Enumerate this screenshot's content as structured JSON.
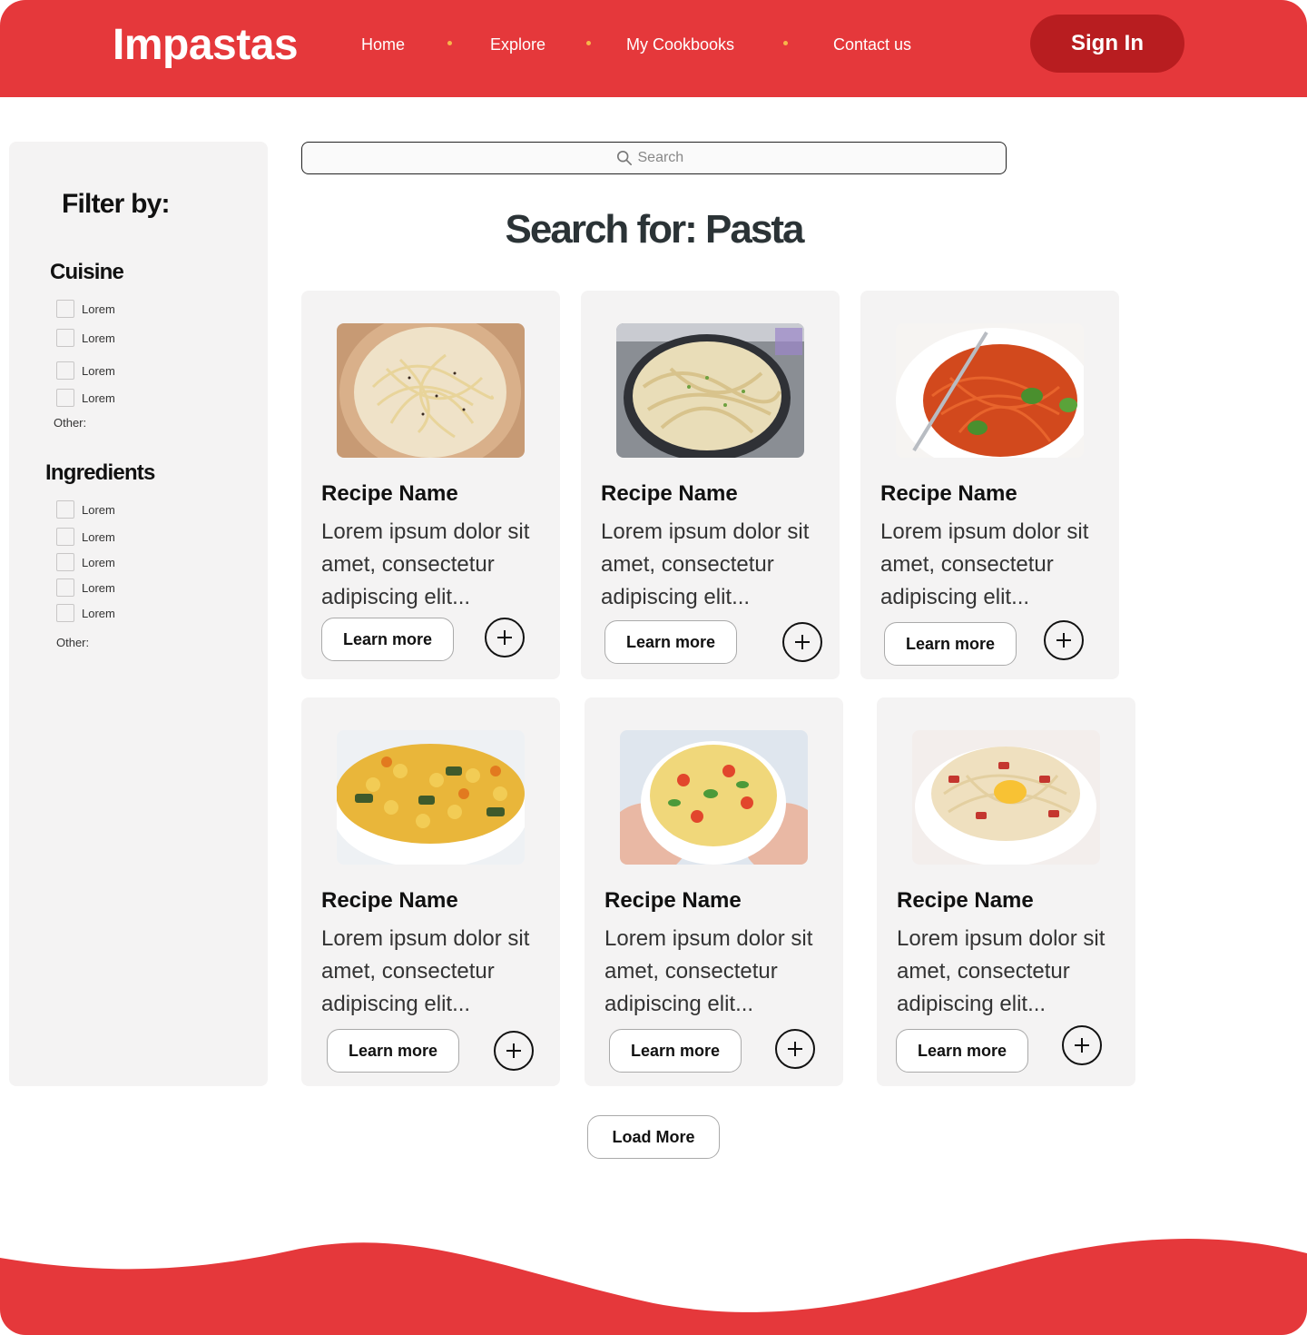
{
  "header": {
    "logo": "Impastas",
    "nav": [
      "Home",
      "Explore",
      "My Cookbooks",
      "Contact us"
    ],
    "sign_in": "Sign In"
  },
  "sidebar": {
    "title": "Filter by:",
    "cuisine": {
      "title": "Cuisine",
      "options": [
        "Lorem",
        "Lorem",
        "Lorem",
        "Lorem"
      ],
      "other": "Other:"
    },
    "ingredients": {
      "title": "Ingredients",
      "options": [
        "Lorem",
        "Lorem",
        "Lorem",
        "Lorem",
        "Lorem"
      ],
      "other": "Other:"
    }
  },
  "search": {
    "placeholder": "Search"
  },
  "results": {
    "title": "Search for: Pasta",
    "cards": [
      {
        "name": "Recipe Name",
        "desc": "Lorem ipsum dolor sit amet, consectetur adipiscing elit...",
        "button": "Learn more"
      },
      {
        "name": "Recipe Name",
        "desc": "Lorem ipsum dolor sit amet, consectetur adipiscing elit...",
        "button": "Learn more"
      },
      {
        "name": "Recipe Name",
        "desc": "Lorem ipsum dolor sit amet, consectetur adipiscing elit...",
        "button": "Learn more"
      },
      {
        "name": "Recipe Name",
        "desc": "Lorem ipsum dolor sit amet, consectetur adipiscing elit...",
        "button": "Learn more"
      },
      {
        "name": "Recipe Name",
        "desc": "Lorem ipsum dolor sit amet, consectetur adipiscing elit...",
        "button": "Learn more"
      },
      {
        "name": "Recipe Name",
        "desc": "Lorem ipsum dolor sit amet, consectetur adipiscing elit...",
        "button": "Learn more"
      }
    ],
    "load_more": "Load More"
  },
  "colors": {
    "brand_red": "#e5383b",
    "sign_in_bg": "#b81d20",
    "nav_dot": "#f7b64a",
    "panel_bg": "#f4f3f3"
  },
  "icons": {
    "search": "search-icon",
    "add": "plus-icon"
  }
}
